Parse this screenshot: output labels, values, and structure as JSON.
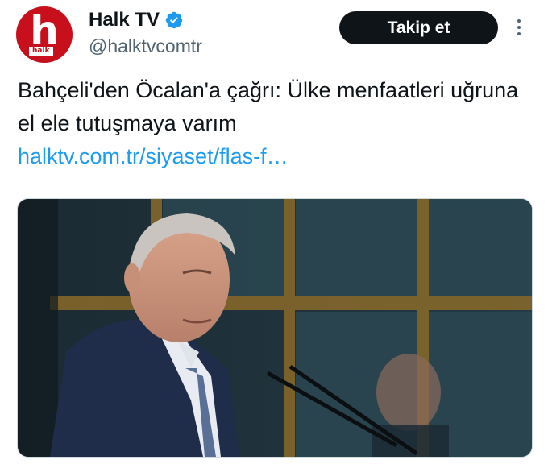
{
  "account": {
    "display_name": "Halk TV",
    "handle": "@halktvcomtr",
    "avatar_letter": "h",
    "avatar_caption": "halk",
    "verified": true,
    "verified_color": "#1d9bf0",
    "brand_color": "#c8101c"
  },
  "actions": {
    "follow_label": "Takip et",
    "more_icon": "more-vertical-icon"
  },
  "tweet": {
    "text": "Bahçeli'den Öcalan'a çağrı: Ülke menfaatleri uğruna el ele tutuşmaya varım",
    "link_text": "halktv.com.tr/siyaset/flas-f…",
    "link_color": "#1d9bf0"
  },
  "media": {
    "kind": "photo"
  }
}
